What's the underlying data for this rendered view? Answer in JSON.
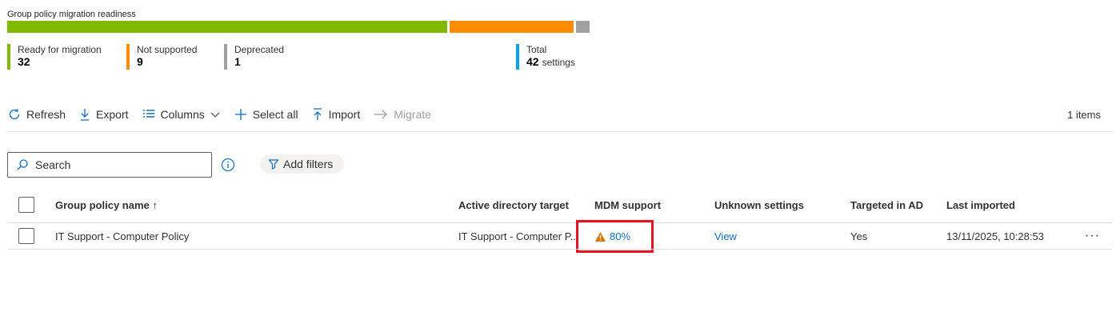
{
  "readiness": {
    "title": "Group policy migration readiness",
    "ready_label": "Ready for migration",
    "ready_value": "32",
    "not_supported_label": "Not supported",
    "not_supported_value": "9",
    "deprecated_label": "Deprecated",
    "deprecated_value": "1",
    "total_label": "Total",
    "total_value": "42",
    "total_unit": "settings",
    "colors": {
      "ready": "#7fba00",
      "not_supported": "#ff8c00",
      "deprecated": "#a0a0a0",
      "total": "#00a2ed"
    }
  },
  "toolbar": {
    "refresh": "Refresh",
    "export": "Export",
    "columns": "Columns",
    "select_all": "Select all",
    "import": "Import",
    "migrate": "Migrate",
    "items_count": "1 items"
  },
  "search": {
    "placeholder": "Search"
  },
  "filters": {
    "add_label": "Add filters"
  },
  "table": {
    "headers": {
      "name": "Group policy name ↑",
      "ad_target": "Active directory target",
      "mdm_support": "MDM support",
      "unknown_settings": "Unknown settings",
      "targeted_in_ad": "Targeted in AD",
      "last_imported": "Last imported"
    },
    "rows": [
      {
        "name": "IT Support - Computer Policy",
        "ad_target": "IT Support - Computer P...",
        "mdm_support": "80%",
        "unknown_settings": "View",
        "targeted_in_ad": "Yes",
        "last_imported": "13/11/2025, 10:28:53",
        "more": "···"
      }
    ]
  },
  "icons": [
    "refresh-icon",
    "export-icon",
    "columns-icon",
    "chevron-down-icon",
    "add-icon",
    "import-icon",
    "arrow-right-icon",
    "search-icon",
    "info-icon",
    "filter-icon",
    "warning-icon",
    "more-icon"
  ]
}
